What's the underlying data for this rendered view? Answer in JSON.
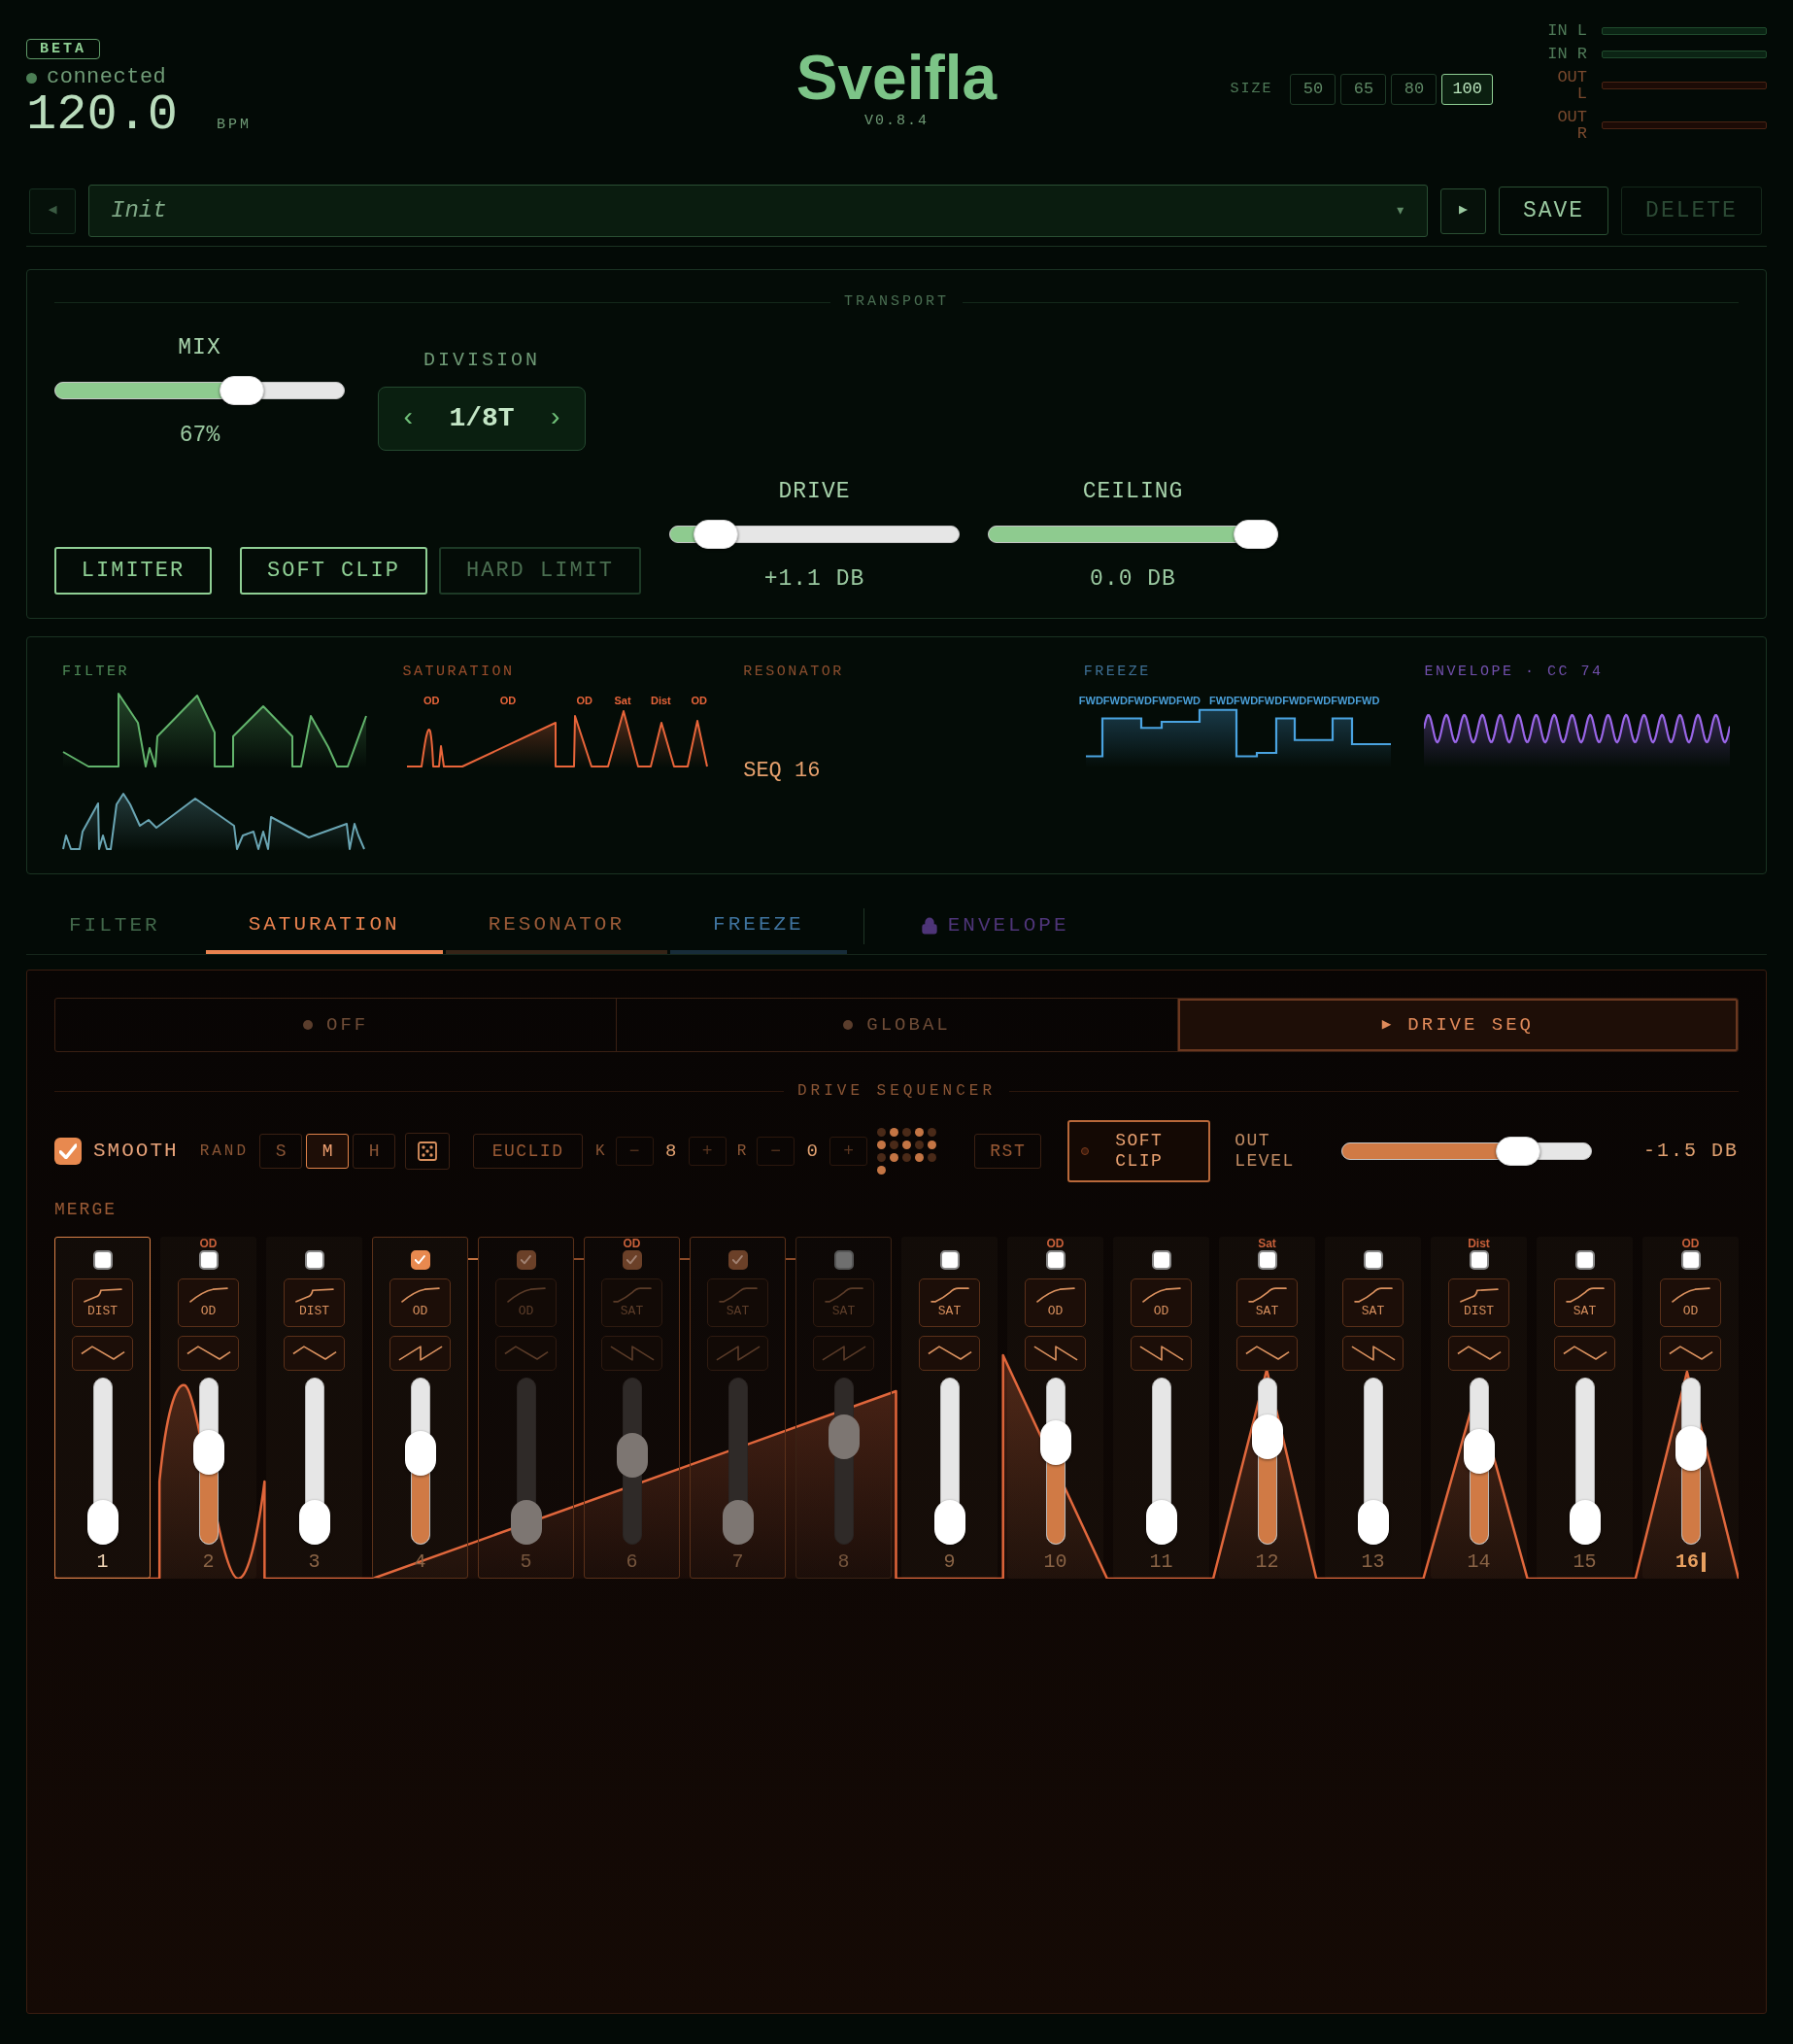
{
  "header": {
    "badge": "BETA",
    "status": "connected",
    "tempo": "120.0",
    "tempo_unit": "BPM",
    "title": "Sveifla",
    "version": "V0.8.4",
    "size_label": "SIZE",
    "sizes": [
      {
        "label": "50",
        "selected": false
      },
      {
        "label": "65",
        "selected": false
      },
      {
        "label": "80",
        "selected": false
      },
      {
        "label": "100",
        "selected": true
      }
    ],
    "meters": [
      {
        "label": "IN L",
        "kind": "input"
      },
      {
        "label": "IN R",
        "kind": "input"
      },
      {
        "label": "OUT L",
        "kind": "output"
      },
      {
        "label": "OUT R",
        "kind": "output"
      }
    ]
  },
  "preset_bar": {
    "previous": "◀",
    "name": "Init",
    "caret": "▾",
    "next": "▶",
    "save": {
      "label": "SAVE",
      "disabled": false
    },
    "delete": {
      "label": "DELETE",
      "disabled": true
    }
  },
  "transport": {
    "title": "TRANSPORT",
    "mix": {
      "label": "MIX",
      "level": 0.67,
      "reading": "67%"
    },
    "division": {
      "label": "DIVISION",
      "previous": "‹",
      "value": "1/8T",
      "next": "›"
    },
    "limiter": {
      "label": "LIMITER",
      "on": true
    },
    "clip_modes": [
      {
        "label": "SOFT CLIP",
        "selected": true
      },
      {
        "label": "HARD LIMIT",
        "selected": false
      }
    ],
    "drive": {
      "label": "DRIVE",
      "level": 0.1,
      "reading": "+1.1 DB"
    },
    "ceiling": {
      "label": "CEILING",
      "level": 1,
      "reading": "0.0 DB"
    }
  },
  "visualizers": [
    {
      "kind": "filter",
      "title": "FILTER",
      "color": "#4f8a58"
    },
    {
      "kind": "saturation",
      "title": "SATURATION",
      "color": "#9a4e2c",
      "labels": [
        "OD",
        "OD",
        "OD",
        "Sat",
        "Dist",
        "OD"
      ]
    },
    {
      "kind": "resonator",
      "title": "RESONATOR",
      "color": "#8a4e2e",
      "readout": "SEQ 16"
    },
    {
      "kind": "freeze",
      "title": "FREEZE",
      "color": "#3e6f94",
      "labels": [
        "FWDFWDFWDFWDFWD",
        "FWDFWDFWDFWDFWDFWDFWD"
      ]
    },
    {
      "kind": "envelope",
      "title": "ENVELOPE · CC 74",
      "color": "#7250ad"
    }
  ],
  "tabs": [
    {
      "label": "FILTER",
      "selected": false,
      "enabled": false,
      "locked": false,
      "color": "#41674a"
    },
    {
      "label": "SATURATION",
      "selected": true,
      "enabled": true,
      "locked": false,
      "color": "#e8824f"
    },
    {
      "label": "RESONATOR",
      "selected": false,
      "enabled": true,
      "locked": false,
      "color": "#9a5a38"
    },
    {
      "label": "FREEZE",
      "selected": false,
      "enabled": true,
      "locked": false,
      "color": "#3f739e"
    },
    {
      "label": "ENVELOPE",
      "selected": false,
      "enabled": false,
      "locked": true,
      "color": "#4e3578"
    }
  ],
  "sequencer": {
    "modes": [
      {
        "label": "OFF",
        "selected": false
      },
      {
        "label": "GLOBAL",
        "selected": false
      },
      {
        "label": "DRIVE SEQ",
        "selected": true,
        "marker": "▶"
      }
    ],
    "title": "DRIVE SEQUENCER",
    "smooth": {
      "label": "SMOOTH",
      "checked": true
    },
    "rand": {
      "label": "RAND",
      "options": [
        {
          "label": "S",
          "selected": false
        },
        {
          "label": "M",
          "selected": true
        },
        {
          "label": "H",
          "selected": false
        }
      ]
    },
    "euclid": {
      "label": "EUCLID",
      "k": {
        "label": "K",
        "decrement": "−",
        "value": "8",
        "increment": "+"
      },
      "r": {
        "label": "R",
        "decrement": "−",
        "value": "0",
        "increment": "+"
      },
      "pattern": [
        false,
        true,
        false,
        true,
        false,
        true,
        false,
        true,
        false,
        true,
        false,
        true,
        false,
        true,
        false,
        true
      ]
    },
    "reset": "RST",
    "soft_clip": {
      "label": "SOFT CLIP",
      "on": true
    },
    "out_level": {
      "label": "OUT LEVEL",
      "level": 0.75,
      "reading": "-1.5 DB"
    },
    "merge_label": "MERGE",
    "steps": [
      {
        "number": "1",
        "merge": false,
        "merged": false,
        "selected": true,
        "playing": false,
        "curve": {
          "kind": "dist",
          "label": "DIST"
        },
        "wave": {
          "kind": "triangle"
        },
        "level": 0
      },
      {
        "number": "2",
        "tag": "OD",
        "merge": false,
        "merged": false,
        "selected": false,
        "playing": false,
        "curve": {
          "kind": "od",
          "label": "OD"
        },
        "wave": {
          "kind": "triangle"
        },
        "level": 0.57
      },
      {
        "number": "3",
        "merge": false,
        "merged": false,
        "selected": false,
        "playing": false,
        "curve": {
          "kind": "dist",
          "label": "DIST"
        },
        "wave": {
          "kind": "triangle"
        },
        "level": 0
      },
      {
        "number": "4",
        "merge": true,
        "merged": false,
        "selected": false,
        "playing": false,
        "curve": {
          "kind": "od",
          "label": "OD"
        },
        "wave": {
          "kind": "ramp"
        },
        "level": 0.56
      },
      {
        "number": "5",
        "merge": true,
        "merged": true,
        "selected": false,
        "playing": false,
        "curve": {
          "kind": "od",
          "label": "OD"
        },
        "wave": {
          "kind": "triangle"
        },
        "level": 0
      },
      {
        "number": "6",
        "tag": "OD",
        "merge": true,
        "merged": true,
        "selected": false,
        "playing": false,
        "curve": {
          "kind": "sat",
          "label": "SAT"
        },
        "wave": {
          "kind": "sawtooth"
        },
        "level": 0.55
      },
      {
        "number": "7",
        "merge": true,
        "merged": true,
        "selected": false,
        "playing": false,
        "curve": {
          "kind": "sat",
          "label": "SAT"
        },
        "wave": {
          "kind": "ramp"
        },
        "level": 0
      },
      {
        "number": "8",
        "merge": false,
        "merged": true,
        "selected": false,
        "playing": false,
        "curve": {
          "kind": "sat",
          "label": "SAT"
        },
        "wave": {
          "kind": "ramp"
        },
        "level": 0.7
      },
      {
        "number": "9",
        "merge": false,
        "merged": false,
        "selected": false,
        "playing": false,
        "curve": {
          "kind": "sat",
          "label": "SAT"
        },
        "wave": {
          "kind": "triangle"
        },
        "level": 0
      },
      {
        "number": "10",
        "tag": "OD",
        "merge": false,
        "merged": false,
        "selected": false,
        "playing": false,
        "curve": {
          "kind": "od",
          "label": "OD"
        },
        "wave": {
          "kind": "sawtooth"
        },
        "level": 0.65
      },
      {
        "number": "11",
        "merge": false,
        "merged": false,
        "selected": false,
        "playing": false,
        "curve": {
          "kind": "od",
          "label": "OD"
        },
        "wave": {
          "kind": "sawtooth"
        },
        "level": 0
      },
      {
        "number": "12",
        "tag": "Sat",
        "merge": false,
        "merged": false,
        "selected": false,
        "playing": false,
        "curve": {
          "kind": "sat",
          "label": "SAT"
        },
        "wave": {
          "kind": "triangle"
        },
        "level": 0.7
      },
      {
        "number": "13",
        "merge": false,
        "merged": false,
        "selected": false,
        "playing": false,
        "curve": {
          "kind": "sat",
          "label": "SAT"
        },
        "wave": {
          "kind": "sawtooth"
        },
        "level": 0
      },
      {
        "number": "14",
        "tag": "Dist",
        "merge": false,
        "merged": false,
        "selected": false,
        "playing": false,
        "curve": {
          "kind": "dist",
          "label": "DIST"
        },
        "wave": {
          "kind": "triangle"
        },
        "level": 0.58
      },
      {
        "number": "15",
        "merge": false,
        "merged": false,
        "selected": false,
        "playing": false,
        "curve": {
          "kind": "sat",
          "label": "SAT"
        },
        "wave": {
          "kind": "triangle"
        },
        "level": 0
      },
      {
        "number": "16",
        "tag": "OD",
        "merge": false,
        "merged": false,
        "selected": false,
        "playing": true,
        "curve": {
          "kind": "od",
          "label": "OD"
        },
        "wave": {
          "kind": "triangle"
        },
        "level": 0.6
      }
    ]
  }
}
